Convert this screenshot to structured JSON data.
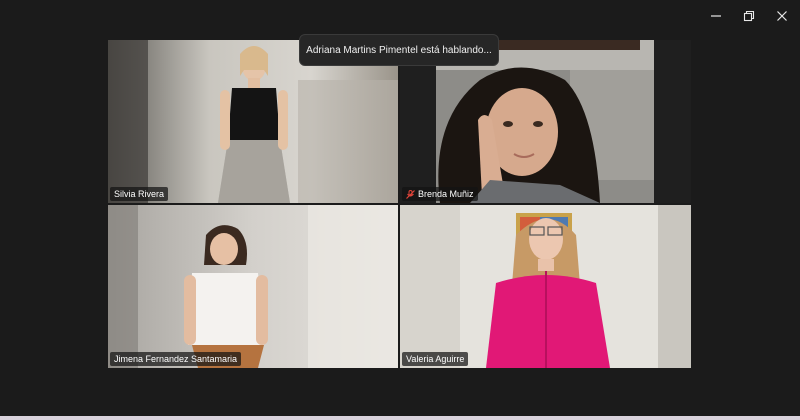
{
  "window": {
    "controls": [
      "minimize-icon",
      "restore-icon",
      "close-icon"
    ]
  },
  "notification": {
    "text": "Adriana Martins Pimentel está hablando..."
  },
  "participants": [
    {
      "name": "Silvia Rivera",
      "muted": false
    },
    {
      "name": "Brenda Muñiz",
      "muted": true
    },
    {
      "name": "Jimena Fernandez Santamaria",
      "muted": false
    },
    {
      "name": "Valeria Aguirre",
      "muted": false
    }
  ],
  "colors": {
    "background": "#1b1b1b",
    "muted_icon": "#e0443a"
  }
}
